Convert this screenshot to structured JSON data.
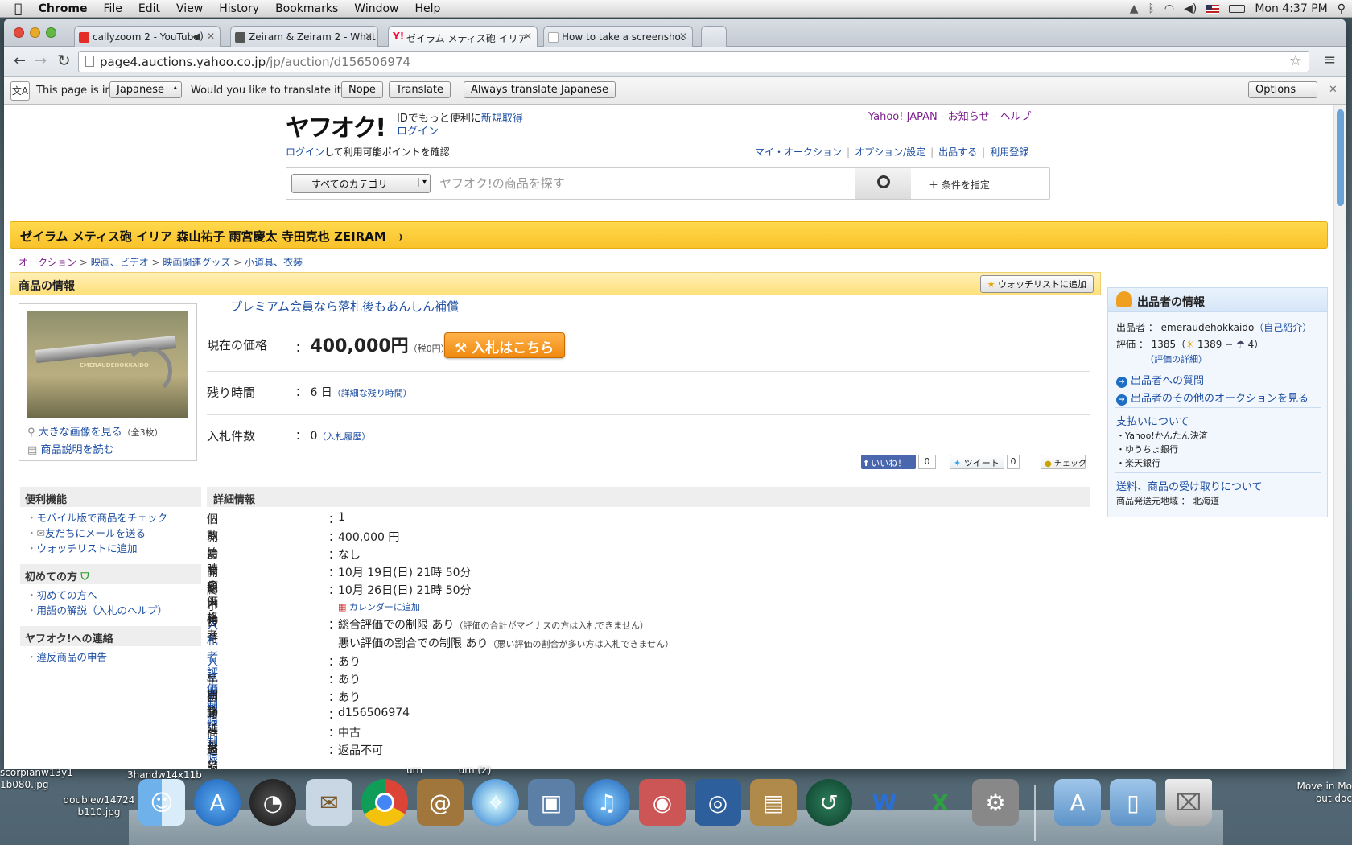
{
  "menubar": {
    "app": "Chrome",
    "items": [
      "File",
      "Edit",
      "View",
      "History",
      "Bookmarks",
      "Window",
      "Help"
    ],
    "clock": "Mon 4:37 PM"
  },
  "tabs": [
    {
      "title": "callyzoom 2 - YouTube",
      "fav_color": "#e52d27"
    },
    {
      "title": "Zeiram & Zeiram 2 - What",
      "fav_color": "#555555"
    },
    {
      "title": "ゼイラム メティス砲 イリア",
      "fav_color": "#ff0033"
    },
    {
      "title": "How to take a screenshot",
      "fav_color": "#cfd6de"
    }
  ],
  "address": {
    "host": "page4.auctions.yahoo.co.jp",
    "path": "/jp/auction/d156506974"
  },
  "translate": {
    "prefix": "This page is in",
    "language": "Japanese",
    "question": "Would you like to translate it?",
    "nope": "Nope",
    "translate": "Translate",
    "always": "Always translate Japanese",
    "options": "Options"
  },
  "header": {
    "logo": "ヤフオク!",
    "promo": "IDでもっと便利に",
    "register": "新規取得",
    "login": "ログイン",
    "points_link": "ログイン",
    "points_text": "して利用可能ポイントを確認",
    "yahoo_japan": "Yahoo! JAPAN",
    "news": "お知らせ",
    "help": "ヘルプ",
    "nav": [
      "マイ・オークション",
      "オプション/設定",
      "出品する",
      "利用登録"
    ],
    "category": "すべてのカテゴリ",
    "search_placeholder": "ヤフオク!の商品を探す",
    "conditions": "条件を指定"
  },
  "title": "ゼイラム メティス砲 イリア 森山祐子 雨宮慶太 寺田克也 ZEIRAM",
  "breadcrumb": [
    "オークション",
    "映画、ビデオ",
    "映画関連グッズ",
    "小道具、衣装"
  ],
  "item": {
    "section_title": "商品の情報",
    "watchlist_button": "ウォッチリストに追加",
    "premium": "プレミアム会員なら落札後もあんしん補償",
    "price_label": "現在の価格",
    "price": "400,000円",
    "tax": "（税0円）",
    "bid_button": "入札はこちら",
    "time_label": "残り時間",
    "time_value": "6 日",
    "time_link": "（詳細な残り時間）",
    "bids_label": "入札件数",
    "bids_value": "0",
    "bids_link": "（入札履歴）",
    "image_watermark": "EMERAUDEHOKKAIDO",
    "large_image": "大きな画像を見る",
    "large_image_count": "（全3枚）",
    "read_desc": "商品説明を読む",
    "like": "いいね！",
    "like_count": "0",
    "tweet": "ツイート",
    "tweet_count": "0",
    "check": "チェック"
  },
  "sidebar": {
    "tools_title": "便利機能",
    "tools": [
      "モバイル版で商品をチェック",
      "友だちにメールを送る",
      "ウォッチリストに追加"
    ],
    "beginner_title": "初めての方",
    "beginner": [
      "初めての方へ",
      "用語の解説（入札のヘルプ）"
    ],
    "contact_title": "ヤフオク!への連絡",
    "contact": [
      "違反商品の申告"
    ]
  },
  "details": {
    "title": "詳細情報",
    "rows": [
      {
        "k": "個数",
        "v": "1"
      },
      {
        "k": "開始時の価格",
        "v": "400,000 円"
      },
      {
        "k": "最高額入札者",
        "v": "なし"
      },
      {
        "k": "開始日時",
        "v": "10月 19日(日) 21時 50分"
      },
      {
        "k": "終了日時",
        "v": "10月 26日(日) 21時 50分"
      }
    ],
    "calendar": "カレンダーに追加",
    "rating_limit_label": "入札者評価制限",
    "rating_limit_1": "総合評価での制限 あり",
    "rating_limit_1_note": "（評価の合計がマイナスの方は入札できません）",
    "rating_limit_2": "悪い評価の割合での制限 あり",
    "rating_limit_2_note": "（悪い評価の割合が多い方は入札できません）",
    "auth_label": "入札者認証制限",
    "auth_value": "あり",
    "rows2": [
      {
        "k": "早期終了",
        "v": "あり"
      },
      {
        "k": "自動延長",
        "v": "あり"
      },
      {
        "k": "オークションID",
        "v": "d156506974"
      },
      {
        "k": "商品の状態",
        "v": "中古"
      },
      {
        "k": "返品の可否",
        "v": "返品不可"
      }
    ]
  },
  "seller": {
    "title": "出品者の情報",
    "seller_label": "出品者 ：",
    "seller_id": "emeraudehokkaido",
    "self_intro": "（自己紹介）",
    "rating_label": "評価 ：",
    "rating": "1385",
    "good": "1389",
    "bad": "4",
    "rating_detail": "（評価の詳細）",
    "question": "出品者への質問",
    "other_auctions": "出品者のその他のオークションを見る",
    "payment_title": "支払いについて",
    "payments": [
      "Yahoo!かんたん決済",
      "ゆうちょ銀行",
      "楽天銀行"
    ],
    "shipping_title": "送料、商品の受け取りについて",
    "origin": "商品発送元地域 ： 北海道"
  },
  "desktop": {
    "left_files": [
      "scorpianw13y1",
      "1b080.jpg",
      "doublew14724",
      "b110.jpg"
    ],
    "behind_labels": [
      "3handw14x11b",
      "urn",
      "urn (2)"
    ],
    "right_label_1": "Move in Mo",
    "right_label_2": "out.doc"
  }
}
